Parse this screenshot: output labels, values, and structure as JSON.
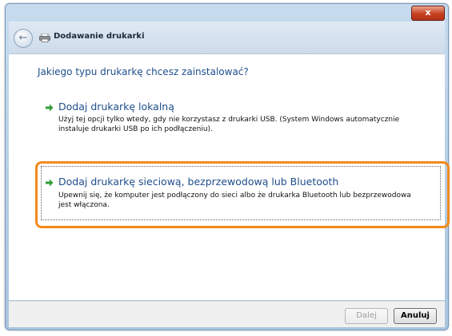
{
  "window": {
    "title": "Dodawanie drukarki",
    "close_label": "x"
  },
  "dialog": {
    "question": "Jakiego typu drukarkę chcesz zainstalować?",
    "options": [
      {
        "title": "Dodaj drukarkę lokalną",
        "description_lines": [
          "Użyj tej opcji tylko wtedy, gdy nie korzystasz z drukarki USB. (System Windows automatycznie",
          "instaluje drukarki USB po ich podłączeniu)."
        ]
      },
      {
        "title": "Dodaj drukarkę sieciową, bezprzewodową lub Bluetooth",
        "description_lines": [
          "Upewnij się, że komputer jest podłączony do sieci albo że drukarka Bluetooth lub bezprzewodowa",
          "jest włączona."
        ]
      }
    ]
  },
  "buttons": {
    "next_label": "Dalej",
    "cancel_label": "Anuluj"
  },
  "colors": {
    "link_blue": "#1f4e8c",
    "arrow_green": "#2e9e36",
    "highlight_orange": "#f28a1c"
  },
  "icons": {
    "back": "back-arrow-icon",
    "app": "printer-icon",
    "option": "green-arrow-icon",
    "close": "close-icon"
  }
}
